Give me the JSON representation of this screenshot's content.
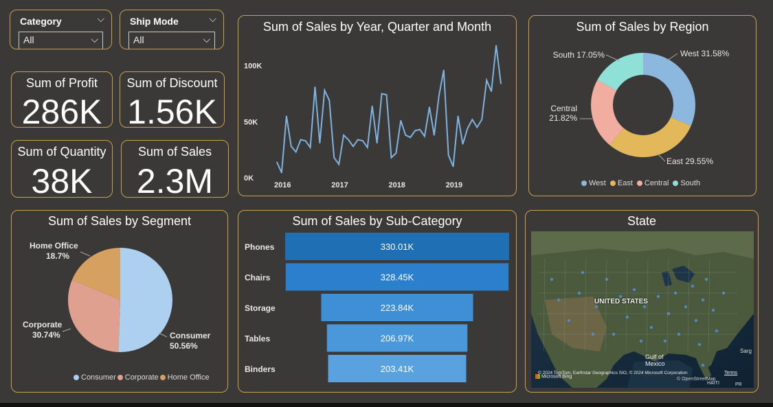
{
  "colors": {
    "border": "#c9a24a",
    "line": "#7fb3e0",
    "region": {
      "West": "#8cb8e0",
      "East": "#e2b85a",
      "Central": "#f0ada0",
      "South": "#8fe0d6"
    },
    "segment": {
      "Consumer": "#aed0f0",
      "Corporate": "#e0a090",
      "Home Office": "#d6a060"
    },
    "bars": [
      "#1f6fb5",
      "#2b7fcc",
      "#3f8fd6",
      "#4a97da",
      "#5aa2df"
    ]
  },
  "slicers": {
    "category": {
      "label": "Category",
      "value": "All"
    },
    "ship_mode": {
      "label": "Ship Mode",
      "value": "All"
    }
  },
  "cards": {
    "profit": {
      "label": "Sum of Profit",
      "value": "286K"
    },
    "discount": {
      "label": "Sum of Discount",
      "value": "1.56K"
    },
    "quantity": {
      "label": "Sum of Quantity",
      "value": "38K"
    },
    "sales": {
      "label": "Sum of Sales",
      "value": "2.3M"
    }
  },
  "map": {
    "title": "State",
    "country_label": "UNITED STATES",
    "gulf_label": "Gulf of\nMexico",
    "attribution": "© 2024 TomTom, Earthstar Geographics SIO, © 2024 Microsoft Corporation",
    "terms": "Terms",
    "osm": "© OpenStreetMap",
    "bing": "Microsoft Bing",
    "sarg": "Sarg",
    "pr": "PR",
    "haiti": "HAITI"
  },
  "chart_data": [
    {
      "type": "line",
      "title": "Sum of Sales by Year, Quarter and Month",
      "yticks": [
        "0K",
        "50K",
        "100K"
      ],
      "ylim": [
        0,
        120000
      ],
      "xticks": [
        "2016",
        "2017",
        "2018",
        "2019"
      ],
      "x": [
        "2016-01",
        "2016-02",
        "2016-03",
        "2016-04",
        "2016-05",
        "2016-06",
        "2016-07",
        "2016-08",
        "2016-09",
        "2016-10",
        "2016-11",
        "2016-12",
        "2017-01",
        "2017-02",
        "2017-03",
        "2017-04",
        "2017-05",
        "2017-06",
        "2017-07",
        "2017-08",
        "2017-09",
        "2017-10",
        "2017-11",
        "2017-12",
        "2018-01",
        "2018-02",
        "2018-03",
        "2018-04",
        "2018-05",
        "2018-06",
        "2018-07",
        "2018-08",
        "2018-09",
        "2018-10",
        "2018-11",
        "2018-12",
        "2019-01",
        "2019-02",
        "2019-03",
        "2019-04",
        "2019-05",
        "2019-06",
        "2019-07",
        "2019-08",
        "2019-09",
        "2019-10",
        "2019-11",
        "2019-12"
      ],
      "values": [
        14000,
        4500,
        55000,
        28000,
        23000,
        34000,
        33000,
        27000,
        81000,
        31000,
        78000,
        69000,
        18000,
        12000,
        38000,
        34000,
        28000,
        34000,
        33000,
        27000,
        64000,
        31000,
        75000,
        74000,
        18000,
        22000,
        51000,
        38000,
        36000,
        42000,
        43000,
        37000,
        63000,
        38000,
        73000,
        96000,
        20000,
        10000,
        55000,
        30000,
        44000,
        52000,
        45000,
        52000,
        87000,
        77000,
        118000,
        84000
      ]
    },
    {
      "type": "pie",
      "title": "Sum of Sales by Region",
      "donut": true,
      "categories": [
        "West",
        "East",
        "Central",
        "South"
      ],
      "values": [
        31.58,
        29.55,
        21.82,
        17.05
      ],
      "labels": [
        "West 31.58%",
        "East 29.55%",
        "Central 21.82%",
        "South 17.05%"
      ],
      "legend": "bottom"
    },
    {
      "type": "pie",
      "title": "Sum of Sales by Segment",
      "categories": [
        "Consumer",
        "Corporate",
        "Home Office"
      ],
      "values": [
        50.56,
        30.74,
        18.7
      ],
      "labels": [
        "Consumer 50.56%",
        "Corporate 30.74%",
        "Home Office 18.7%"
      ],
      "legend": "bottom"
    },
    {
      "type": "bar",
      "orientation": "horizontal-funnel",
      "title": "Sum of Sales by Sub-Category",
      "categories": [
        "Phones",
        "Chairs",
        "Storage",
        "Tables",
        "Binders"
      ],
      "values": [
        330010,
        328450,
        223840,
        206970,
        203410
      ],
      "data_labels": [
        "330.01K",
        "328.45K",
        "223.84K",
        "206.97K",
        "203.41K"
      ]
    }
  ]
}
